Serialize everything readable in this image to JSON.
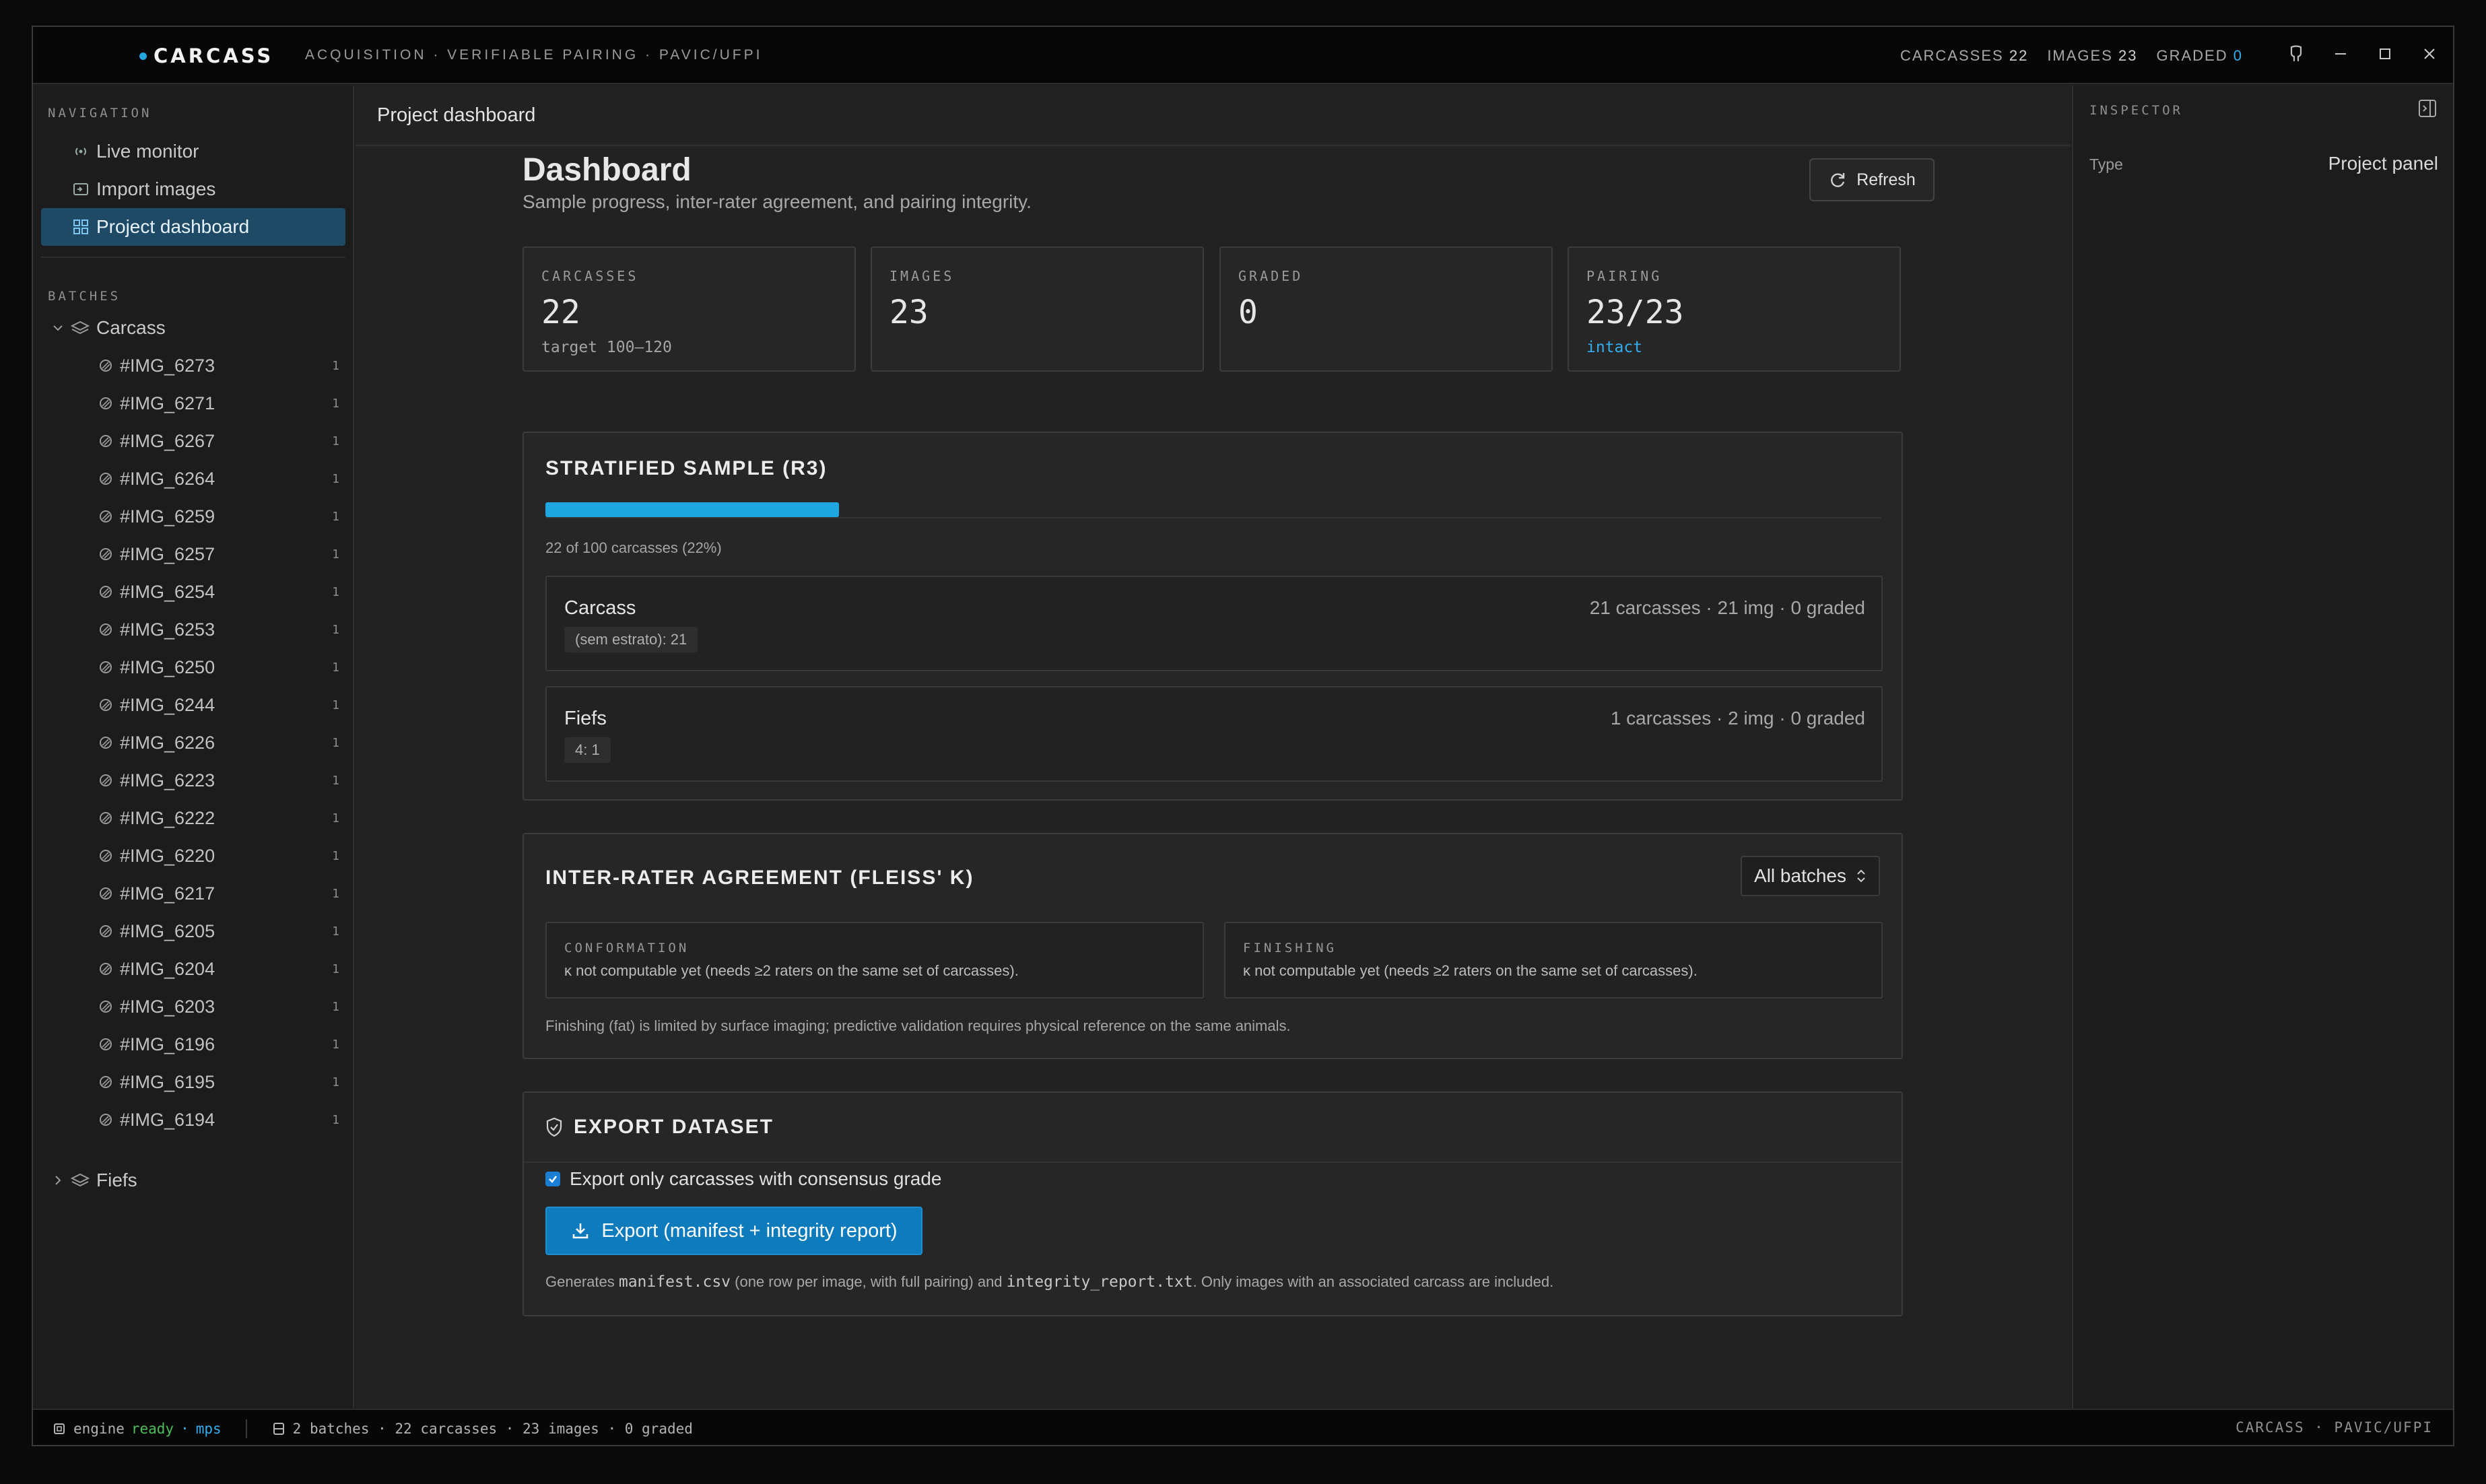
{
  "app": {
    "brand": "CARCASS",
    "subtitle": "ACQUISITION · VERIFIABLE PAIRING · PAVIC/UFPI",
    "stats": [
      {
        "label": "CARCASSES",
        "value": "22"
      },
      {
        "label": "IMAGES",
        "value": "23"
      },
      {
        "label": "GRADED",
        "value": "0"
      }
    ]
  },
  "sidebar": {
    "nav_label": "NAVIGATION",
    "nav": [
      {
        "label": "Live monitor",
        "icon": "broadcast-icon"
      },
      {
        "label": "Import images",
        "icon": "import-icon"
      },
      {
        "label": "Project dashboard",
        "icon": "grid-icon",
        "active": true
      }
    ],
    "batches_label": "BATCHES",
    "batches": [
      {
        "name": "Carcass",
        "expanded": true,
        "items": [
          {
            "label": "#IMG_6273",
            "count": "1"
          },
          {
            "label": "#IMG_6271",
            "count": "1"
          },
          {
            "label": "#IMG_6267",
            "count": "1"
          },
          {
            "label": "#IMG_6264",
            "count": "1"
          },
          {
            "label": "#IMG_6259",
            "count": "1"
          },
          {
            "label": "#IMG_6257",
            "count": "1"
          },
          {
            "label": "#IMG_6254",
            "count": "1"
          },
          {
            "label": "#IMG_6253",
            "count": "1"
          },
          {
            "label": "#IMG_6250",
            "count": "1"
          },
          {
            "label": "#IMG_6244",
            "count": "1"
          },
          {
            "label": "#IMG_6226",
            "count": "1"
          },
          {
            "label": "#IMG_6223",
            "count": "1"
          },
          {
            "label": "#IMG_6222",
            "count": "1"
          },
          {
            "label": "#IMG_6220",
            "count": "1"
          },
          {
            "label": "#IMG_6217",
            "count": "1"
          },
          {
            "label": "#IMG_6205",
            "count": "1"
          },
          {
            "label": "#IMG_6204",
            "count": "1"
          },
          {
            "label": "#IMG_6203",
            "count": "1"
          },
          {
            "label": "#IMG_6196",
            "count": "1"
          },
          {
            "label": "#IMG_6195",
            "count": "1"
          },
          {
            "label": "#IMG_6194",
            "count": "1"
          }
        ]
      },
      {
        "name": "Fiefs",
        "expanded": false,
        "items": []
      }
    ]
  },
  "main": {
    "header": "Project dashboard",
    "title": "Dashboard",
    "subtitle": "Sample progress, inter-rater agreement, and pairing integrity.",
    "refresh_label": "Refresh",
    "stats": [
      {
        "label": "CARCASSES",
        "value": "22",
        "note": "target 100–120"
      },
      {
        "label": "IMAGES",
        "value": "23",
        "note": ""
      },
      {
        "label": "GRADED",
        "value": "0",
        "note": ""
      },
      {
        "label": "PAIRING",
        "value": "23/23",
        "note": "intact"
      }
    ],
    "sample": {
      "title": "STRATIFIED SAMPLE (R3)",
      "progress_fraction": 0.22,
      "progress_text": "22 of 100 carcasses (22%)",
      "strata": [
        {
          "name": "Carcass",
          "meta": "21 carcasses · 21 img · 0 graded",
          "tag": "(sem estrato): 21"
        },
        {
          "name": "Fiefs",
          "meta": "1 carcasses · 2 img · 0 graded",
          "tag": "4: 1"
        }
      ]
    },
    "fleiss": {
      "title": "INTER-RATER AGREEMENT (FLEISS' K)",
      "select_value": "All batches",
      "boxes": [
        {
          "label": "CONFORMATION",
          "text": "κ not computable yet (needs ≥2 raters on the same set of carcasses)."
        },
        {
          "label": "FINISHING",
          "text": "κ not computable yet (needs ≥2 raters on the same set of carcasses)."
        }
      ],
      "note": "Finishing (fat) is limited by surface imaging; predictive validation requires physical reference on the same animals."
    },
    "export": {
      "title": "EXPORT DATASET",
      "checkbox_label": "Export only carcasses with consensus grade",
      "checkbox_checked": true,
      "button_label": "Export (manifest + integrity report)",
      "note_pre": "Generates ",
      "note_code1": "manifest.csv",
      "note_mid": " (one row per image, with full pairing) and ",
      "note_code2": "integrity_report.txt",
      "note_post": ". Only images with an associated carcass are included."
    }
  },
  "inspector": {
    "title": "INSPECTOR",
    "type_key": "Type",
    "type_value": "Project panel"
  },
  "statusbar": {
    "engine_label": "engine",
    "engine_state": "ready",
    "engine_sep": "·",
    "engine_device": "mps",
    "summary": "2 batches · 22 carcasses · 23 images · 0 graded",
    "right": "CARCASS · PAVIC/UFPI"
  },
  "colors": {
    "accent": "#1ea6e0",
    "active_nav": "#1e4a66",
    "ready_green": "#4cbf5a",
    "export_button": "#0e7bbd"
  }
}
